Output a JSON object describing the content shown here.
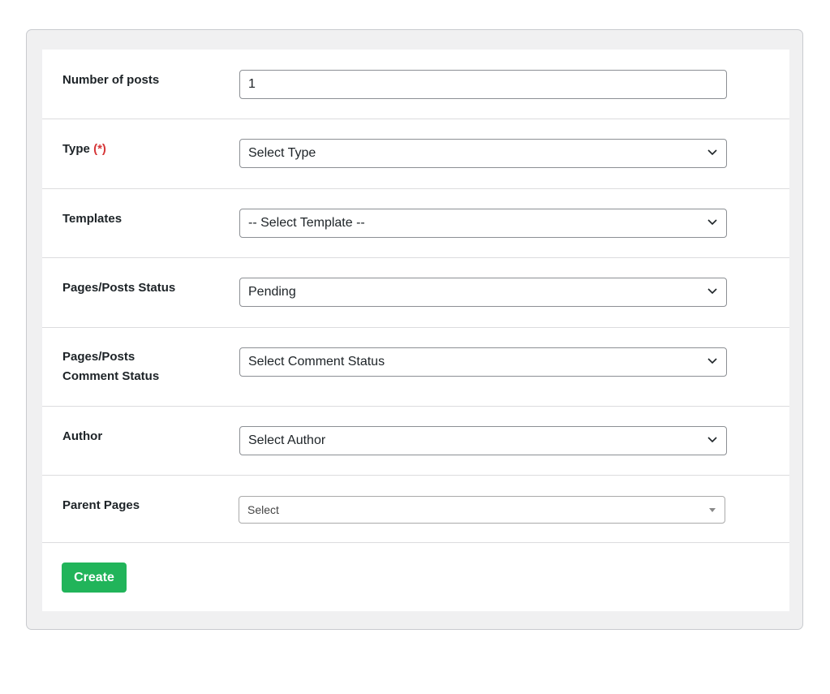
{
  "form": {
    "fields": [
      {
        "label": "Number of posts",
        "value": "1"
      },
      {
        "label": "Type",
        "required_marker": "(*)",
        "value": "Select Type"
      },
      {
        "label": "Templates",
        "value": "-- Select Template --"
      },
      {
        "label": "Pages/Posts Status",
        "value": "Pending"
      },
      {
        "label_line1": "Pages/Posts",
        "label_line2": "Comment Status",
        "value": "Select Comment Status"
      },
      {
        "label": "Author",
        "value": "Select Author"
      },
      {
        "label": "Parent Pages",
        "value": "Select"
      }
    ],
    "submit_label": "Create"
  },
  "colors": {
    "accent_button": "#21b45a",
    "required_marker": "#d63638",
    "panel_background": "#f0f0f1"
  },
  "icons": {
    "dropdown": "chevron-down-icon",
    "select2_arrow": "triangle-down-icon"
  }
}
